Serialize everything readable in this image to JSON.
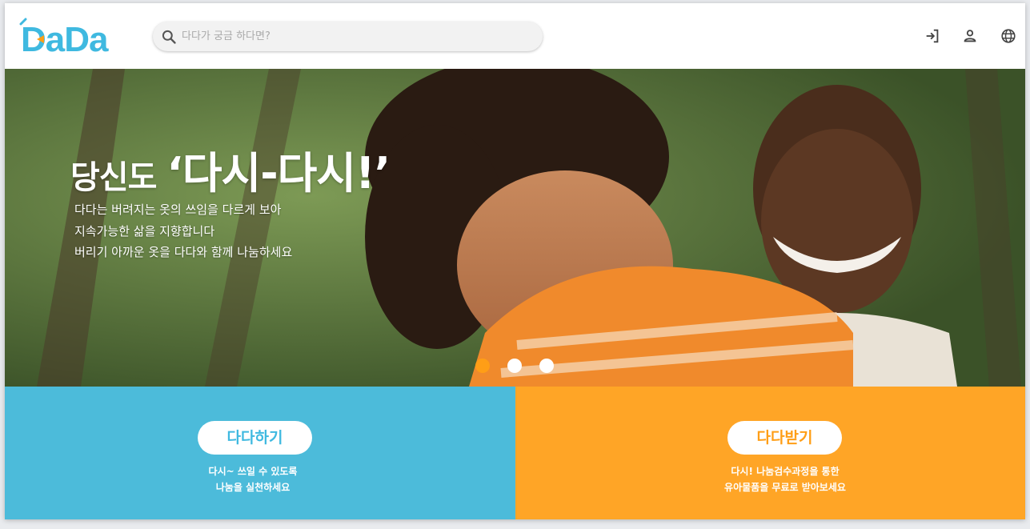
{
  "header": {
    "logo_text": "DaDa",
    "search": {
      "placeholder": "다다가 궁금 하다면?",
      "value": ""
    },
    "icons": [
      "login-icon",
      "user-icon",
      "globe-icon"
    ]
  },
  "hero": {
    "title_prefix": "당신도 ",
    "title_quote_open": "‘",
    "title_main": "다시-다시!",
    "title_quote_close": "’",
    "lines": [
      "다다는 버려지는 옷의 쓰임을 다르게 보아",
      "지속가능한 삶을 지향합니다",
      "버리기 아까운 옷을 다다와 함께 나눔하세요"
    ],
    "slides": 3,
    "active_slide": 0
  },
  "panels": {
    "give": {
      "button_label": "다다하기",
      "lines": [
        "다시~ 쓰일 수 있도록",
        "나눔을 실천하세요"
      ]
    },
    "receive": {
      "button_label": "다다받기",
      "lines": [
        "다시!  나눔검수과정을 통한",
        "유아물품을 무료로 받아보세요"
      ]
    }
  },
  "colors": {
    "brand_blue": "#3fb9e0",
    "brand_orange": "#ff9e16",
    "panel_blue": "#38b4d6",
    "panel_orange": "#ff9e16"
  }
}
